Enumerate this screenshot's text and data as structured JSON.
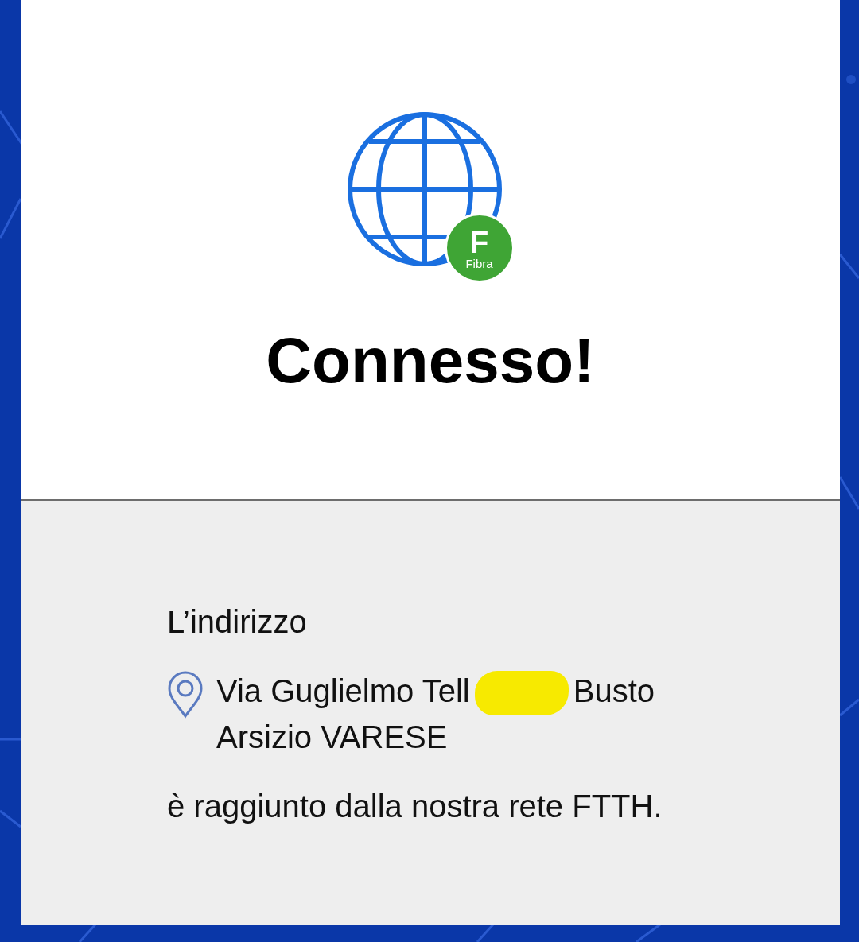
{
  "status": {
    "title": "Connesso!",
    "badge_letter": "F",
    "badge_label": "Fibra"
  },
  "address": {
    "label": "L’indirizzo",
    "street": "Via Guglielmo Tell",
    "redacted": true,
    "city": "Busto Arsizio VARESE"
  },
  "message": "è raggiunto dalla nostra rete FTTH."
}
